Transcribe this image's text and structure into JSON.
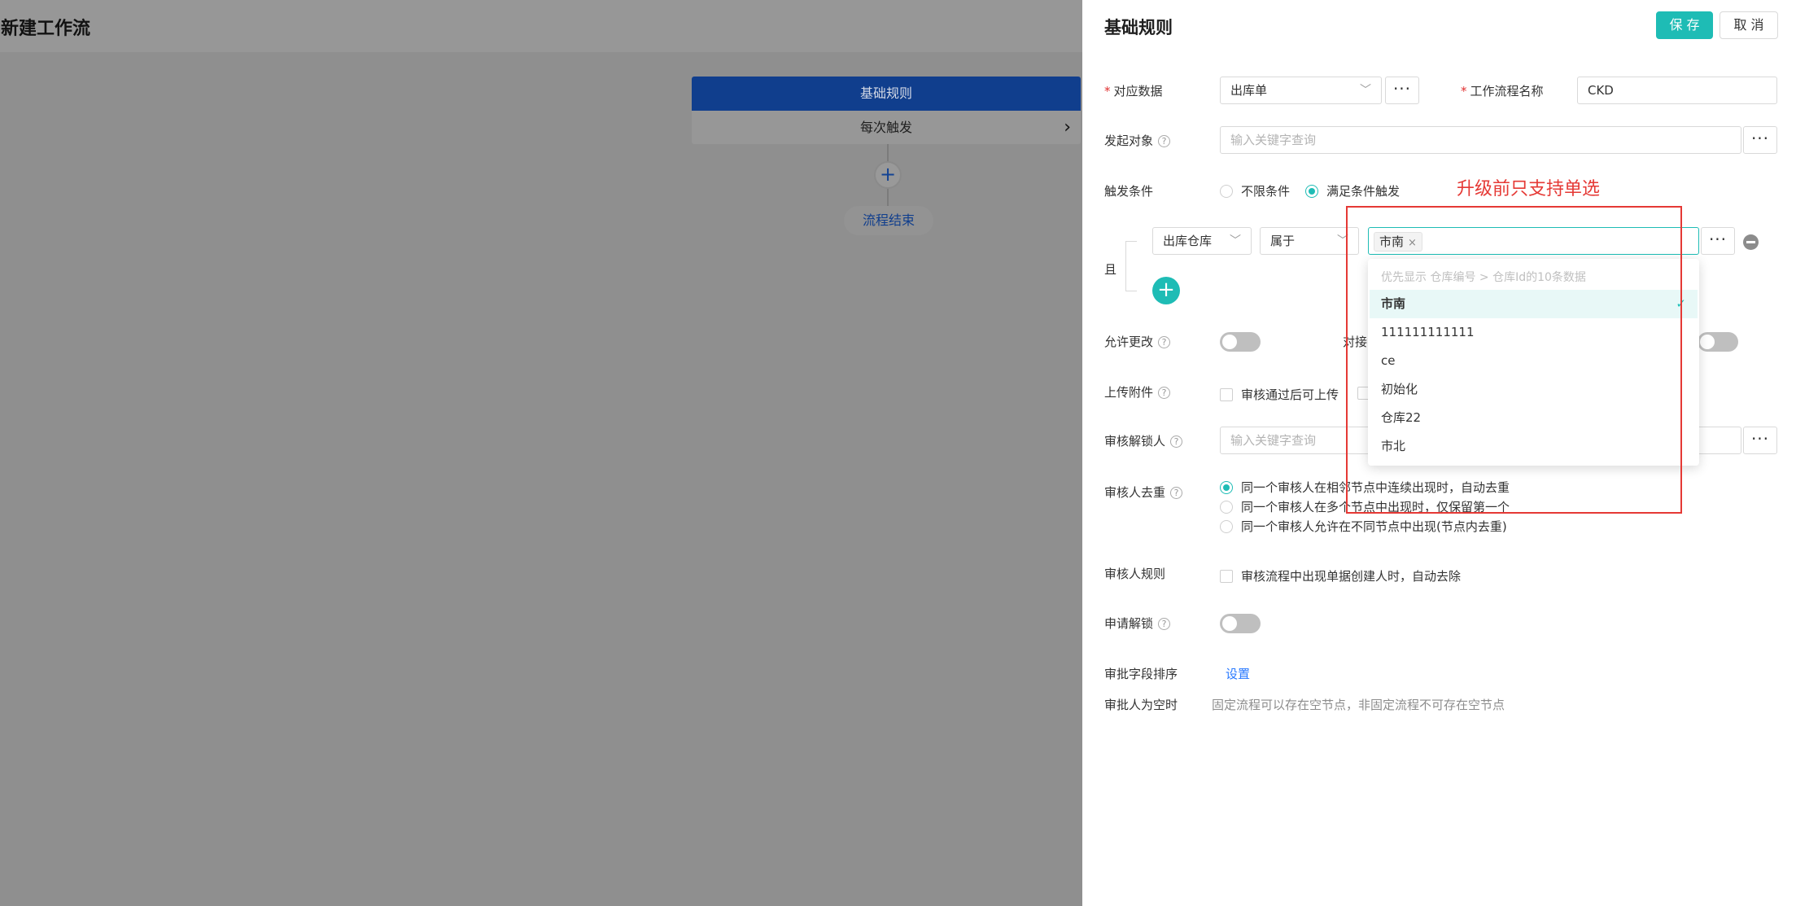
{
  "left": {
    "page_title": "新建工作流",
    "node_title": "基础规则",
    "node_sub": "每次触发",
    "node_arrow": "›",
    "add_symbol": "+",
    "end_label": "流程结束"
  },
  "drawer": {
    "title": "基础规则",
    "save": "保 存",
    "cancel": "取 消",
    "rows": {
      "data_label": "对应数据",
      "data_value": "出库单",
      "name_label": "工作流程名称",
      "name_value": "CKD",
      "initiator_label": "发起对象",
      "initiator_placeholder": "输入关键字查询",
      "trigger_label": "触发条件",
      "trigger_opt1": "不限条件",
      "trigger_opt2": "满足条件触发",
      "and_label": "且",
      "cond_field": "出库仓库",
      "cond_op": "属于",
      "cond_tag": "市南",
      "allow_edit_label": "允许更改",
      "dock_label": "对接",
      "upload_label": "上传附件",
      "upload_opt": "审核通过后可上传",
      "unlock_label": "审核解锁人",
      "unlock_placeholder": "输入关键字查询",
      "dedup_label": "审核人去重",
      "dedup_opt1": "同一个审核人在相邻节点中连续出现时，自动去重",
      "dedup_opt2": "同一个审核人在多个节点中出现时，仅保留第一个",
      "dedup_opt3": "同一个审核人允许在不同节点中出现(节点内去重)",
      "rule_label": "审核人规则",
      "rule_opt": "审核流程中出现单据创建人时，自动去除",
      "apply_unlock_label": "申请解锁",
      "field_order_label": "审批字段排序",
      "field_order_link": "设置",
      "empty_label": "审批人为空时",
      "empty_desc": "固定流程可以存在空节点，非固定流程不可存在空节点"
    },
    "dropdown": {
      "hint": "优先显示 仓库编号 > 仓库Id的10条数据",
      "items": [
        "市南",
        "111111111111",
        "ce",
        "初始化",
        "仓库22",
        "市北"
      ],
      "selected_check": "✓"
    },
    "annotation": "升级前只支持单选",
    "dots": "···",
    "chevron": "﹀",
    "req_mark": "*",
    "help_mark": "?",
    "tag_close": "×",
    "plus": "+"
  },
  "colors": {
    "accent": "#1ebcb5",
    "node_blue": "#103e8d",
    "annotation_red": "#e53935",
    "link": "#2979ff"
  }
}
